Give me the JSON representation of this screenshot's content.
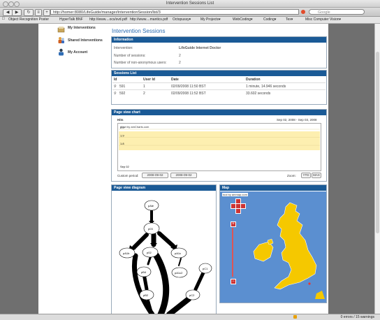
{
  "window": {
    "title": "Intervention Sessions List",
    "url": "http://homer:8080/LifeGuide/manager/interventionSession/list/3",
    "search_placeholder": "Google"
  },
  "toolbar": {
    "back_icon": "back-arrow-icon",
    "forward_icon": "forward-arrow-icon",
    "reload_icon": "reload-icon",
    "add_icon": "plus-icon"
  },
  "bookmarks": [
    "Object Recognition Poster",
    "HyperTalk BNF",
    "http://www....ocs/svd.pdf",
    "http://www....mantics.pdf",
    "Octopussy▾",
    "My Projects▾",
    "WebCoding▾",
    "Coding▾",
    "Tex▾",
    "Misc Computer Vision▾"
  ],
  "sidebar": [
    {
      "label": "My Interventions"
    },
    {
      "label": "Shared Interventions"
    },
    {
      "label": "My Account"
    }
  ],
  "page_title": "Intervention Sessions",
  "information": {
    "title": "Information",
    "rows": [
      {
        "key": "Intervention:",
        "value": "LifeGuide Internet Doctor"
      },
      {
        "key": "Number of sessions:",
        "value": "2"
      },
      {
        "key": "Number of non-anonymous users:",
        "value": "2"
      }
    ]
  },
  "sessions": {
    "title": "Sessions List",
    "columns": [
      "Id",
      "User Id",
      "Date",
      "Duration"
    ],
    "rows": [
      {
        "id": "591",
        "user_id": "1",
        "date": "02/09/2008 11:50 BST",
        "duration": "1 minute, 14.946 seconds"
      },
      {
        "id": "592",
        "user_id": "2",
        "date": "02/09/2008 11:52 BST",
        "duration": "33.602 seconds"
      }
    ]
  },
  "page_view_chart": {
    "title": "Page view chart",
    "series_label": "Hits",
    "date_range": "Sep 02, 2008 - Sep 03, 2008",
    "credit": "chart by amCharts.com",
    "period_label": "Custom period:",
    "period_from": "2008-09-02",
    "period_to": "2008-09-02",
    "zoom_label": "Zoom:",
    "zoom_buttons": [
      "YTD",
      "MAX"
    ]
  },
  "chart_data": {
    "type": "area",
    "categories": [
      "Sep 02"
    ],
    "ylim": [
      1.6,
      2.0
    ],
    "yticks": [
      "2.0",
      "1.9",
      "1.8"
    ],
    "xtick_labels": [
      "Sep 02"
    ]
  },
  "diagram": {
    "title": "Page view diagram",
    "nodes": [
      "pAle",
      "p03",
      "pA1b",
      "p02",
      "pA1c",
      "pB4",
      "pA1c2",
      "pC1",
      "pB2",
      "pC2"
    ]
  },
  "map": {
    "title": "Map",
    "credit": "tool by ammap.com"
  },
  "status": {
    "text": "0 errors / 15 warnings"
  },
  "colors": {
    "panel_header": "#1a5a96",
    "title_blue": "#2a6bb0",
    "land": "#f5c800",
    "sea": "#5b8fd0",
    "chart_band": "#fdefb0"
  }
}
